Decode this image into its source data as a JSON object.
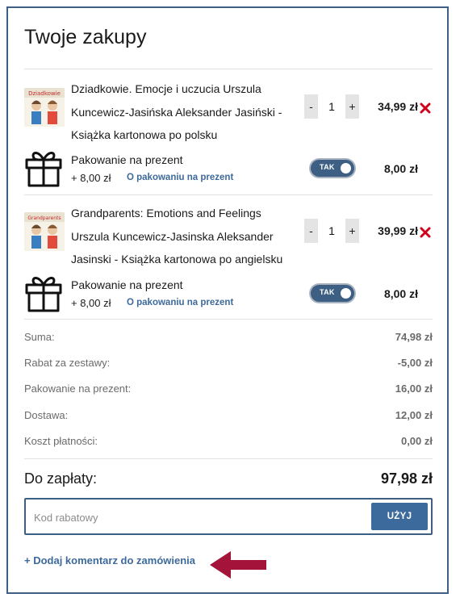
{
  "cart": {
    "title": "Twoje zakupy",
    "items": [
      {
        "name": "Dziadkowie. Emocje i uczucia Urszula Kuncewicz-Jasińska Aleksander Jasiński - Książka kartonowa po polsku",
        "thumb_text": "Dziadkowie",
        "qty_minus": "-",
        "qty": "1",
        "qty_plus": "+",
        "price": "34,99 zł",
        "gift": {
          "title": "Pakowanie na prezent",
          "price": "+ 8,00 zł",
          "link": "O pakowaniu na prezent",
          "toggle": "TAK",
          "amount": "8,00 zł"
        }
      },
      {
        "name": "Grandparents: Emotions and Feelings Urszula Kuncewicz-Jasinska Aleksander Jasinski - Książka kartonowa po angielsku",
        "thumb_text": "Grandparents",
        "qty_minus": "-",
        "qty": "1",
        "qty_plus": "+",
        "price": "39,99 zł",
        "gift": {
          "title": "Pakowanie na prezent",
          "price": "+ 8,00 zł",
          "link": "O pakowaniu na prezent",
          "toggle": "TAK",
          "amount": "8,00 zł"
        }
      }
    ]
  },
  "summary": {
    "rows": [
      {
        "label": "Suma:",
        "value": "74,98 zł"
      },
      {
        "label": "Rabat za zestawy:",
        "value": "-5,00 zł"
      },
      {
        "label": "Pakowanie na prezent:",
        "value": "16,00 zł"
      },
      {
        "label": "Dostawa:",
        "value": "12,00 zł"
      },
      {
        "label": "Koszt płatności:",
        "value": "0,00 zł"
      }
    ],
    "total_label": "Do zapłaty:",
    "total_value": "97,98 zł"
  },
  "coupon": {
    "placeholder": "Kod rabatowy",
    "apply_label": "UŻYJ"
  },
  "comment_link": "+ Dodaj komentarz do zamówienia",
  "colors": {
    "border": "#3d5f84",
    "accent": "#3d6a9c",
    "remove": "#d0021b",
    "arrow": "#a3133a"
  }
}
